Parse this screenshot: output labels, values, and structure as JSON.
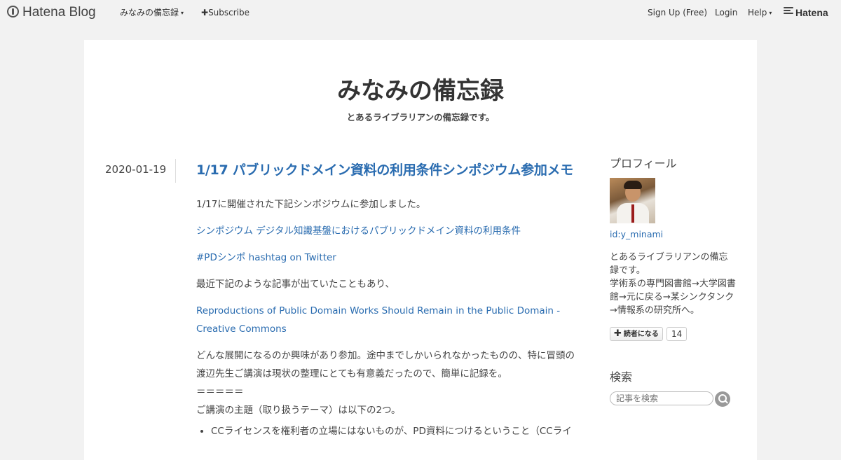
{
  "topbar": {
    "logo_text": "Hatena Blog",
    "blog_menu": "みなみの備忘録",
    "subscribe": "Subscribe",
    "signup": "Sign Up (Free)",
    "login": "Login",
    "help": "Help",
    "brand": "Hatena"
  },
  "blog": {
    "title": "みなみの備忘録",
    "description": "とあるライブラリアンの備忘録です。"
  },
  "entry": {
    "date": "2020-01-19",
    "title": "1/17 パブリックドメイン資料の利用条件シンポジウム参加メモ",
    "p1": "1/17に開催された下記シンポジウムに参加しました。",
    "link1": "シンポジウム デジタル知識基盤におけるパブリックドメイン資料の利用条件",
    "link2": "#PDシンポ hashtag on Twitter",
    "p2": "最近下記のような記事が出ていたこともあり、",
    "link3": "Reproductions of Public Domain Works Should Remain in the Public Domain - Creative Commons",
    "p3_line1": "どんな展開になるのか興味があり参加。途中までしかいられなかったものの、特に冒頭の",
    "p3_line2": "渡辺先生ご講演は現状の整理にとても有意義だったので、簡単に記録を。",
    "p3_line3": "＝＝＝＝＝",
    "p3_line4": "ご講演の主題（取り扱うテーマ）は以下の2つ。",
    "list": [
      "CCライセンスを権利者の立場にはないものが、PD資料につけるということ（CCライ"
    ]
  },
  "sidebar": {
    "profile_heading": "プロフィール",
    "profile_id": "id:y_minami",
    "profile_desc_1": "とあるライブラリアンの備忘録です。",
    "profile_desc_2": "学術系の専門図書館→大学図書館→元に戻る→某シンクタンク→情報系の研究所へ。",
    "reader_button": "読者になる",
    "reader_count": "14",
    "search_heading": "検索",
    "search_placeholder": "記事を検索"
  }
}
